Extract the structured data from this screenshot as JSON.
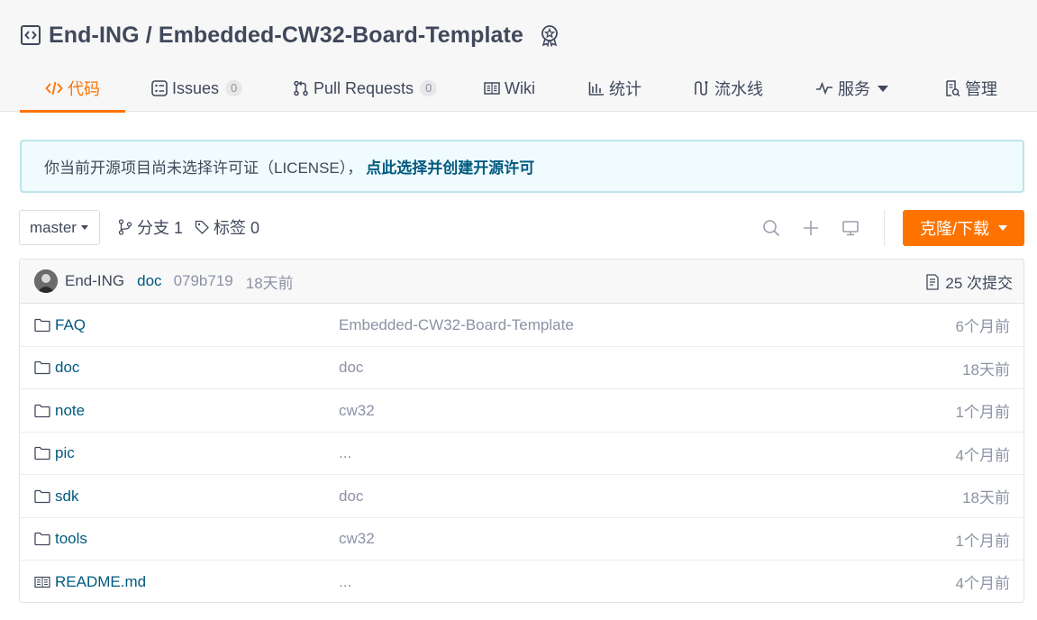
{
  "repo": {
    "title": "End-ING / Embedded-CW32-Board-Template"
  },
  "tabs": [
    {
      "label": "代码",
      "icon": "code-icon"
    },
    {
      "label": "Issues",
      "icon": "issues-icon",
      "count": "0"
    },
    {
      "label": "Pull Requests",
      "icon": "pull-request-icon",
      "count": "0"
    },
    {
      "label": "Wiki",
      "icon": "wiki-icon"
    },
    {
      "label": "统计",
      "icon": "stats-icon"
    },
    {
      "label": "流水线",
      "icon": "pipeline-icon"
    },
    {
      "label": "服务",
      "icon": "service-icon"
    },
    {
      "label": "管理",
      "icon": "manage-icon"
    }
  ],
  "notice": {
    "text": "你当前开源项目尚未选择许可证（LICENSE），",
    "link": "点此选择并创建开源许可"
  },
  "toolbar": {
    "branch": "master",
    "branches_label": "分支 1",
    "tags_label": "标签 0",
    "clone_label": "克隆/下载"
  },
  "commit": {
    "author": "End-ING",
    "message": "doc",
    "sha": "079b719",
    "time": "18天前",
    "count_label": "25 次提交"
  },
  "files": [
    {
      "name": "FAQ",
      "type": "folder",
      "message": "Embedded-CW32-Board-Template",
      "time": "6个月前"
    },
    {
      "name": "doc",
      "type": "folder",
      "message": "doc",
      "time": "18天前"
    },
    {
      "name": "note",
      "type": "folder",
      "message": "cw32",
      "time": "1个月前"
    },
    {
      "name": "pic",
      "type": "folder",
      "message": "...",
      "time": "4个月前"
    },
    {
      "name": "sdk",
      "type": "folder",
      "message": "doc",
      "time": "18天前"
    },
    {
      "name": "tools",
      "type": "folder",
      "message": "cw32",
      "time": "1个月前"
    },
    {
      "name": "README.md",
      "type": "file",
      "message": "...",
      "time": "4个月前"
    }
  ],
  "colors": {
    "accent": "#fe7300",
    "link": "#005980",
    "muted": "#8c92a4",
    "text": "#40485b"
  }
}
